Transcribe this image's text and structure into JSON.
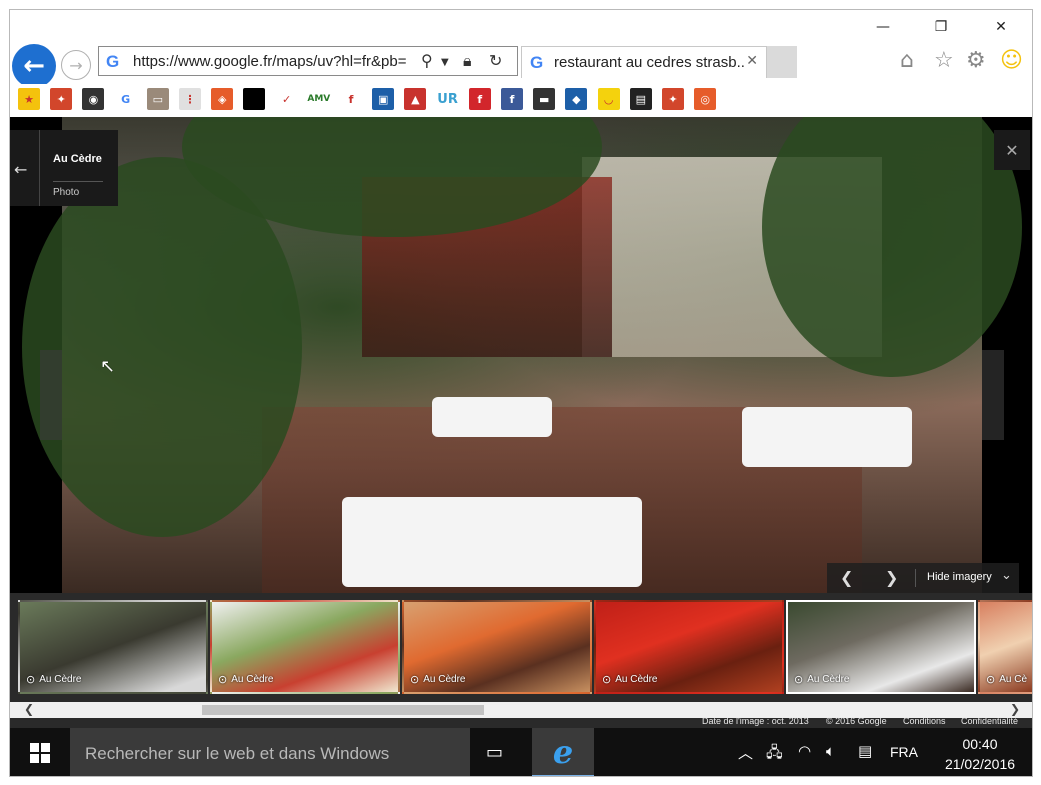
{
  "window": {
    "minimize_glyph": "—",
    "restore_glyph": "❐",
    "close_glyph": "✕"
  },
  "browser": {
    "url": "https://www.google.fr/maps/uv?hl=fr&pb=",
    "tab_title": "restaurant au cedres strasb...",
    "tab_close": "✕"
  },
  "icons": {
    "back": "back-arrow-icon",
    "forward": "forward-arrow-icon",
    "search": "search-icon",
    "lock": "lock-icon",
    "refresh": "refresh-icon",
    "home": "home-icon",
    "favorites": "star-icon",
    "settings": "gear-icon",
    "feedback": "smiley-icon"
  },
  "favorites_bar": [
    {
      "name": "add-favorite",
      "color": "#f4c20d",
      "glyph": "★"
    },
    {
      "name": "site-1",
      "color": "#d2462b",
      "glyph": "✦"
    },
    {
      "name": "tripadvisor",
      "color": "#333333",
      "glyph": "◉"
    },
    {
      "name": "google",
      "color": "#ffffff",
      "glyph": "G"
    },
    {
      "name": "site-4",
      "color": "#9a8a7a",
      "glyph": "▭"
    },
    {
      "name": "site-5",
      "color": "#e0e0e0",
      "glyph": "⋮"
    },
    {
      "name": "site-6",
      "color": "#e65c2a",
      "glyph": "◈"
    },
    {
      "name": "site-7",
      "color": "#000000",
      "glyph": ""
    },
    {
      "name": "nike",
      "color": "#ffffff",
      "glyph": "✓"
    },
    {
      "name": "amv",
      "color": "#ffffff",
      "glyph": "AMV"
    },
    {
      "name": "site-10",
      "color": "#ffffff",
      "glyph": "f"
    },
    {
      "name": "site-11",
      "color": "#1d5fa8",
      "glyph": "▣"
    },
    {
      "name": "site-12",
      "color": "#c8322d",
      "glyph": "▲"
    },
    {
      "name": "ur",
      "color": "#ffffff",
      "glyph": "UR"
    },
    {
      "name": "site-14",
      "color": "#d2262b",
      "glyph": "f"
    },
    {
      "name": "facebook",
      "color": "#3b5998",
      "glyph": "f"
    },
    {
      "name": "site-16",
      "color": "#333333",
      "glyph": "▬"
    },
    {
      "name": "site-17",
      "color": "#1d5fa8",
      "glyph": "◆"
    },
    {
      "name": "site-18",
      "color": "#f4d20d",
      "glyph": "◡"
    },
    {
      "name": "site-19",
      "color": "#222222",
      "glyph": "▤"
    },
    {
      "name": "site-20",
      "color": "#d2462b",
      "glyph": "✦"
    },
    {
      "name": "site-21",
      "color": "#e65c2a",
      "glyph": "◎"
    }
  ],
  "viewer": {
    "place_name": "Au Cèdre",
    "media_type": "Photo",
    "back_glyph": "←",
    "close_glyph": "✕",
    "prev_glyph": "❮",
    "next_glyph": "❯",
    "hide_imagery": "Hide imagery",
    "collapse_glyph": "⌄"
  },
  "thumbnails": [
    {
      "caption": "Au Cèdre",
      "camera": "⊙",
      "selected": false
    },
    {
      "caption": "Au Cèdre",
      "camera": "⊙",
      "selected": false
    },
    {
      "caption": "Au Cèdre",
      "camera": "⊙",
      "selected": false
    },
    {
      "caption": "Au Cèdre",
      "camera": "⊙",
      "selected": false
    },
    {
      "caption": "Au Cèdre",
      "camera": "⊙",
      "selected": true
    },
    {
      "caption": "Au Cè",
      "camera": "⊙",
      "selected": false
    }
  ],
  "scrollbar": {
    "left_glyph": "❮",
    "right_glyph": "❯"
  },
  "footer": {
    "image_date": "Date de l'image : oct. 2013",
    "copyright": "© 2016 Google",
    "terms": "Conditions",
    "privacy": "Confidentialité"
  },
  "taskbar": {
    "search_placeholder": "Rechercher sur le web et dans Windows",
    "task_view_glyph": "▭",
    "ie_glyph": "e",
    "tray_up": "︿",
    "tray_network": "network-icon",
    "tray_wifi": "wifi-icon",
    "tray_volume": "volume-icon",
    "tray_notifications": "notifications-icon",
    "language": "FRA",
    "time": "00:40",
    "date": "21/02/2016"
  }
}
